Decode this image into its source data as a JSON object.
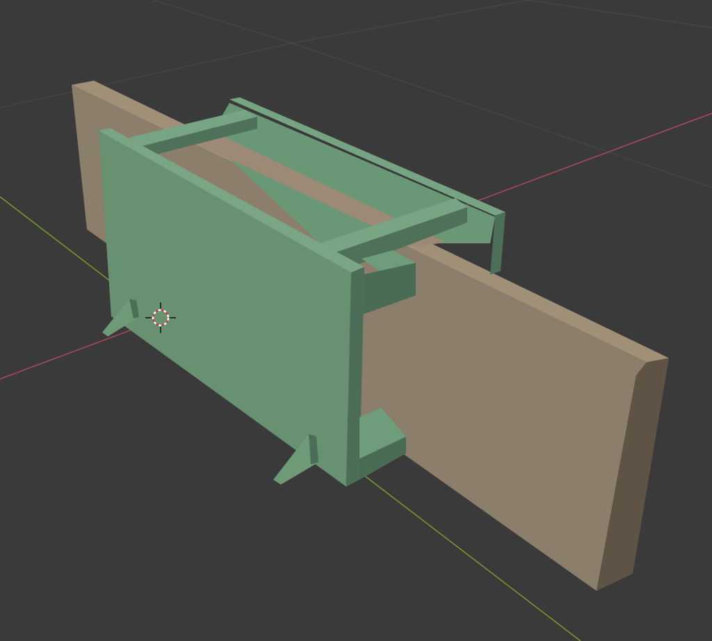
{
  "scene": {
    "background": "#3a3a3a",
    "grid_color": "#4a4a4a",
    "x_axis_color": "#b5485a",
    "y_axis_color": "#7fa231",
    "board_colors": {
      "face": "#8c7f6b",
      "top": "#9a8a74",
      "side": "#5f5445"
    },
    "form_colors": {
      "face": "#689273",
      "light": "#74a07f",
      "dark": "#4b6c55",
      "edge": "#58805f"
    },
    "icons": {
      "cursor": "3d-cursor-icon"
    }
  }
}
